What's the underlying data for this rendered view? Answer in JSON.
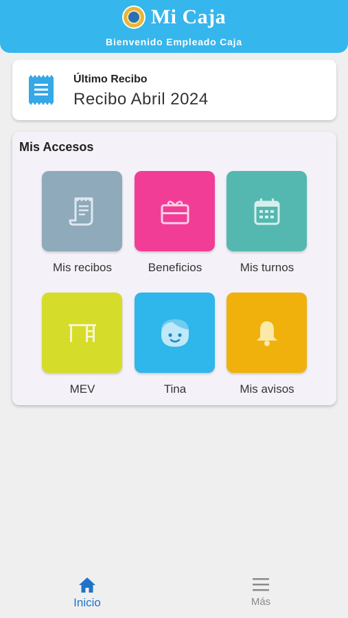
{
  "header": {
    "title": "Mi Caja",
    "subtitle": "Bienvenido Empleado Caja",
    "background": "#35b6ec",
    "logo_icon": "caja-logo-icon"
  },
  "last_receipt": {
    "label": "Último Recibo",
    "value": "Recibo Abril 2024",
    "icon": "receipt-icon"
  },
  "access": {
    "title": "Mis Accesos",
    "tiles": [
      {
        "label": "Mis recibos",
        "icon": "receipt-scroll-icon",
        "color": "#8eaabb"
      },
      {
        "label": "Beneficios",
        "icon": "gift-card-icon",
        "color": "#f23d96"
      },
      {
        "label": "Mis turnos",
        "icon": "calendar-icon",
        "color": "#54b8b0"
      },
      {
        "label": "MEV",
        "icon": "desk-icon",
        "color": "#d6dc2a"
      },
      {
        "label": "Tina",
        "icon": "face-icon",
        "color": "#2fb6ea"
      },
      {
        "label": "Mis avisos",
        "icon": "bell-icon",
        "color": "#f0b10c"
      }
    ]
  },
  "nav": {
    "items": [
      {
        "label": "Inicio",
        "icon": "home-icon",
        "active": true,
        "color": "#1f74c9"
      },
      {
        "label": "Más",
        "icon": "menu-icon",
        "active": false,
        "color": "#8a8a8a"
      }
    ]
  }
}
